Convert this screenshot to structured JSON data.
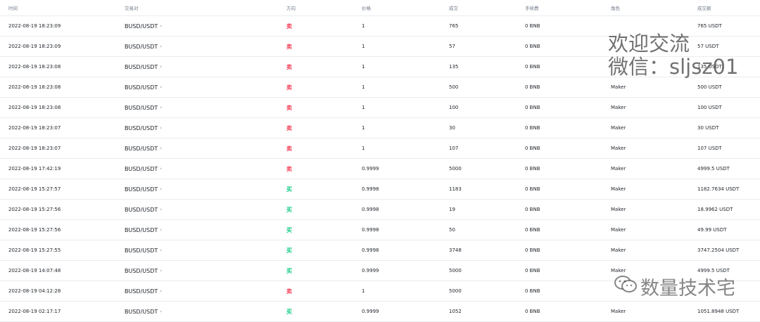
{
  "headers": {
    "time": "时间",
    "pair": "交易对",
    "side": "方向",
    "price": "价格",
    "qty": "成交",
    "fee": "手续费",
    "role": "角色",
    "total": "成交额"
  },
  "colors": {
    "sell": "#f6465d",
    "buy": "#0ecb81"
  },
  "rows": [
    {
      "time": "2022-08-19 18:23:09",
      "pair": "BUSD/USDT",
      "side": "卖",
      "side_type": "sell",
      "price": "1",
      "qty": "765",
      "fee": "0 BNB",
      "role": "",
      "total": "765 USDT"
    },
    {
      "time": "2022-08-19 18:23:09",
      "pair": "BUSD/USDT",
      "side": "卖",
      "side_type": "sell",
      "price": "1",
      "qty": "57",
      "fee": "0 BNB",
      "role": "",
      "total": "57 USDT"
    },
    {
      "time": "2022-08-19 18:23:08",
      "pair": "BUSD/USDT",
      "side": "卖",
      "side_type": "sell",
      "price": "1",
      "qty": "135",
      "fee": "0 BNB",
      "role": "",
      "total": "135 USDT"
    },
    {
      "time": "2022-08-19 18:23:08",
      "pair": "BUSD/USDT",
      "side": "卖",
      "side_type": "sell",
      "price": "1",
      "qty": "500",
      "fee": "0 BNB",
      "role": "Maker",
      "total": "500 USDT"
    },
    {
      "time": "2022-08-19 18:23:08",
      "pair": "BUSD/USDT",
      "side": "卖",
      "side_type": "sell",
      "price": "1",
      "qty": "100",
      "fee": "0 BNB",
      "role": "Maker",
      "total": "100 USDT"
    },
    {
      "time": "2022-08-19 18:23:07",
      "pair": "BUSD/USDT",
      "side": "卖",
      "side_type": "sell",
      "price": "1",
      "qty": "30",
      "fee": "0 BNB",
      "role": "Maker",
      "total": "30 USDT"
    },
    {
      "time": "2022-08-19 18:23:07",
      "pair": "BUSD/USDT",
      "side": "卖",
      "side_type": "sell",
      "price": "1",
      "qty": "107",
      "fee": "0 BNB",
      "role": "Maker",
      "total": "107 USDT"
    },
    {
      "time": "2022-08-19 17:42:19",
      "pair": "BUSD/USDT",
      "side": "卖",
      "side_type": "sell",
      "price": "0.9999",
      "qty": "5000",
      "fee": "0 BNB",
      "role": "Maker",
      "total": "4999.5 USDT"
    },
    {
      "time": "2022-08-19 15:27:57",
      "pair": "BUSD/USDT",
      "side": "买",
      "side_type": "buy",
      "price": "0.9998",
      "qty": "1183",
      "fee": "0 BNB",
      "role": "Maker",
      "total": "1182.7634 USDT"
    },
    {
      "time": "2022-08-19 15:27:56",
      "pair": "BUSD/USDT",
      "side": "买",
      "side_type": "buy",
      "price": "0.9998",
      "qty": "19",
      "fee": "0 BNB",
      "role": "Maker",
      "total": "18.9962 USDT"
    },
    {
      "time": "2022-08-19 15:27:56",
      "pair": "BUSD/USDT",
      "side": "买",
      "side_type": "buy",
      "price": "0.9998",
      "qty": "50",
      "fee": "0 BNB",
      "role": "Maker",
      "total": "49.99 USDT"
    },
    {
      "time": "2022-08-19 15:27:55",
      "pair": "BUSD/USDT",
      "side": "买",
      "side_type": "buy",
      "price": "0.9998",
      "qty": "3748",
      "fee": "0 BNB",
      "role": "Maker",
      "total": "3747.2504 USDT"
    },
    {
      "time": "2022-08-19 14:07:48",
      "pair": "BUSD/USDT",
      "side": "买",
      "side_type": "buy",
      "price": "0.9999",
      "qty": "5000",
      "fee": "0 BNB",
      "role": "Maker",
      "total": "4999.5 USDT"
    },
    {
      "time": "2022-08-19 04:12:28",
      "pair": "BUSD/USDT",
      "side": "卖",
      "side_type": "sell",
      "price": "1",
      "qty": "5000",
      "fee": "0 BNB",
      "role": "",
      "total": ""
    },
    {
      "time": "2022-08-19 02:17:17",
      "pair": "BUSD/USDT",
      "side": "买",
      "side_type": "buy",
      "price": "0.9999",
      "qty": "1052",
      "fee": "0 BNB",
      "role": "Maker",
      "total": "1051.8948 USDT"
    }
  ],
  "watermark": {
    "line1": "欢迎交流",
    "line2": "微信：sljsz01",
    "brand": "数量技术宅"
  }
}
